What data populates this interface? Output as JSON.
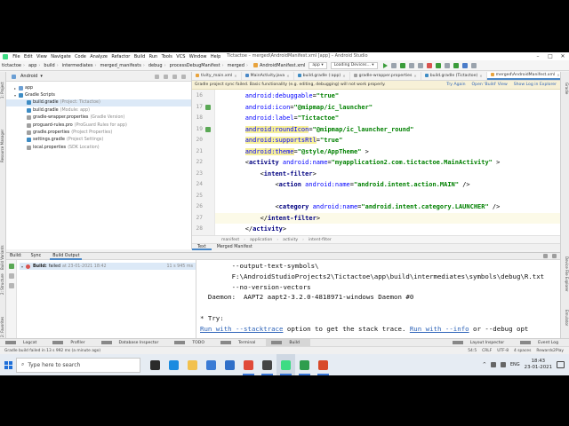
{
  "window": {
    "title": "Tictactoe – merged\\AndroidManifest.xml [app] – Android Studio",
    "menu": [
      "File",
      "Edit",
      "View",
      "Navigate",
      "Code",
      "Analyze",
      "Refactor",
      "Build",
      "Run",
      "Tools",
      "VCS",
      "Window",
      "Help"
    ],
    "controls": [
      "–",
      "□",
      "✕"
    ]
  },
  "navbar": {
    "breadcrumbs": [
      "tictactoe",
      "app",
      "build",
      "intermediates",
      "merged_manifests",
      "debug",
      "processDebugManifest",
      "merged"
    ],
    "file": "AndroidManifest.xml",
    "config_combo": "app",
    "device_combo": "Loading Devices..."
  },
  "project_panel": {
    "view_combo": "Android",
    "tree": [
      {
        "label": "app",
        "hint": "",
        "icon": "folder",
        "indent": 1,
        "caret": "▸",
        "selected": false
      },
      {
        "label": "Gradle Scripts",
        "hint": "",
        "icon": "gradle",
        "indent": 1,
        "caret": "▾",
        "selected": false
      },
      {
        "label": "build.gradle",
        "hint": "(Project: Tictactoe)",
        "icon": "gradle",
        "indent": 2,
        "caret": "",
        "selected": true
      },
      {
        "label": "build.gradle",
        "hint": "(Module: app)",
        "icon": "gradle",
        "indent": 2,
        "caret": "",
        "selected": false
      },
      {
        "label": "gradle-wrapper.properties",
        "hint": "(Gradle Version)",
        "icon": "props",
        "indent": 2,
        "caret": "",
        "selected": false
      },
      {
        "label": "proguard-rules.pro",
        "hint": "(ProGuard Rules for app)",
        "icon": "props",
        "indent": 2,
        "caret": "",
        "selected": false
      },
      {
        "label": "gradle.properties",
        "hint": "(Project Properties)",
        "icon": "props",
        "indent": 2,
        "caret": "",
        "selected": false
      },
      {
        "label": "settings.gradle",
        "hint": "(Project Settings)",
        "icon": "gradle",
        "indent": 2,
        "caret": "",
        "selected": false
      },
      {
        "label": "local.properties",
        "hint": "(SDK Location)",
        "icon": "props",
        "indent": 2,
        "caret": "",
        "selected": false
      }
    ]
  },
  "editor_tabs": [
    {
      "label": "tivity_main.xml",
      "active": false,
      "color": "#e8a33d"
    },
    {
      "label": "MainActivity.java",
      "active": false,
      "color": "#4a88c7"
    },
    {
      "label": "build.gradle (:app)",
      "active": false,
      "color": "#3e8cc4"
    },
    {
      "label": "gradle-wrapper.properties",
      "active": false,
      "color": "#a0a0a0"
    },
    {
      "label": "build.gradle (Tictactoe)",
      "active": false,
      "color": "#3e8cc4"
    },
    {
      "label": "merged\\AndroidManifest.xml",
      "active": true,
      "color": "#e8a33d"
    }
  ],
  "banner": {
    "message": "Gradle project sync failed. Basic functionality (e.g. editing, debugging) will not work properly.",
    "actions": [
      "Try Again",
      "Open 'Build' View",
      "Show Log in Explorer"
    ]
  },
  "editor": {
    "lines": [
      {
        "n": "16",
        "marker": false,
        "hl": false,
        "tokens": [
          [
            "",
            "        "
          ],
          [
            "attr",
            "android:debuggable"
          ],
          [
            "brk",
            "="
          ],
          [
            "val",
            "\"true\""
          ]
        ]
      },
      {
        "n": "17",
        "marker": true,
        "hl": false,
        "tokens": [
          [
            "",
            "        "
          ],
          [
            "attr",
            "android:icon"
          ],
          [
            "brk",
            "="
          ],
          [
            "val",
            "\"@mipmap/ic_launcher\""
          ]
        ]
      },
      {
        "n": "18",
        "marker": false,
        "hl": false,
        "tokens": [
          [
            "",
            "        "
          ],
          [
            "attr",
            "android:label"
          ],
          [
            "brk",
            "="
          ],
          [
            "val",
            "\"Tictactoe\""
          ]
        ]
      },
      {
        "n": "19",
        "marker": true,
        "hl": false,
        "tokens": [
          [
            "",
            "        "
          ],
          [
            "attr hlbg",
            "android:roundIcon"
          ],
          [
            "brk",
            "="
          ],
          [
            "val",
            "\"@mipmap/ic_launcher_round\""
          ]
        ]
      },
      {
        "n": "20",
        "marker": false,
        "hl": false,
        "tokens": [
          [
            "",
            "        "
          ],
          [
            "attr hlbg",
            "android:supportsRtl"
          ],
          [
            "brk",
            "="
          ],
          [
            "val",
            "\"true\""
          ]
        ]
      },
      {
        "n": "21",
        "marker": false,
        "hl": false,
        "tokens": [
          [
            "",
            "        "
          ],
          [
            "attr hlbg",
            "android:theme"
          ],
          [
            "brk",
            "="
          ],
          [
            "val",
            "\"@style/AppTheme\""
          ],
          [
            "brk",
            " >"
          ]
        ]
      },
      {
        "n": "22",
        "marker": false,
        "hl": false,
        "tokens": [
          [
            "",
            "        "
          ],
          [
            "brk",
            "<"
          ],
          [
            "tag",
            "activity"
          ],
          [
            "",
            " "
          ],
          [
            "attr",
            "android:name"
          ],
          [
            "brk",
            "="
          ],
          [
            "val",
            "\"myapplication2.com.tictactoe.MainActivity\""
          ],
          [
            "brk",
            " >"
          ]
        ]
      },
      {
        "n": "23",
        "marker": false,
        "hl": false,
        "tokens": [
          [
            "",
            "            "
          ],
          [
            "brk",
            "<"
          ],
          [
            "tag",
            "intent-filter"
          ],
          [
            "brk",
            ">"
          ]
        ]
      },
      {
        "n": "24",
        "marker": false,
        "hl": false,
        "tokens": [
          [
            "",
            "                "
          ],
          [
            "brk",
            "<"
          ],
          [
            "tag",
            "action"
          ],
          [
            "",
            " "
          ],
          [
            "attr",
            "android:name"
          ],
          [
            "brk",
            "="
          ],
          [
            "val",
            "\"android.intent.action.MAIN\""
          ],
          [
            "brk",
            " />"
          ]
        ]
      },
      {
        "n": "25",
        "marker": false,
        "hl": false,
        "tokens": [
          [
            "",
            ""
          ]
        ]
      },
      {
        "n": "26",
        "marker": false,
        "hl": false,
        "tokens": [
          [
            "",
            "                "
          ],
          [
            "brk",
            "<"
          ],
          [
            "tag",
            "category"
          ],
          [
            "",
            " "
          ],
          [
            "attr",
            "android:name"
          ],
          [
            "brk",
            "="
          ],
          [
            "val",
            "\"android.intent.category.LAUNCHER\""
          ],
          [
            "brk",
            " />"
          ]
        ]
      },
      {
        "n": "27",
        "marker": false,
        "hl": true,
        "tokens": [
          [
            "",
            "            "
          ],
          [
            "brk",
            "</"
          ],
          [
            "tag",
            "intent-filter"
          ],
          [
            "brk",
            ">"
          ]
        ]
      },
      {
        "n": "28",
        "marker": false,
        "hl": false,
        "tokens": [
          [
            "",
            "        "
          ],
          [
            "brk",
            "</"
          ],
          [
            "tag",
            "activity"
          ],
          [
            "brk",
            ">"
          ]
        ]
      }
    ]
  },
  "editor_breadcrumb": [
    "manifest",
    "application",
    "activity",
    "intent-filter"
  ],
  "editor_view_tabs": [
    {
      "label": "Text",
      "active": true
    },
    {
      "label": "Merged Manifest",
      "active": false
    }
  ],
  "build_panel": {
    "label": "Build:",
    "tabs": [
      {
        "label": "Sync",
        "active": false
      },
      {
        "label": "Build Output",
        "active": true
      }
    ],
    "row": {
      "status": "Build:",
      "result": "failed",
      "time": "at 23-01-2021 18:42",
      "duration": "11 s 945 ms"
    },
    "console": [
      {
        "text": "        --output-text-symbols\\",
        "link": ""
      },
      {
        "text": "        F:\\AndroidStudioProjects2\\Tictactoe\\app\\build\\intermediates\\symbols\\debug\\R.txt",
        "link": ""
      },
      {
        "text": "        --no-version-vectors",
        "link": ""
      },
      {
        "text": "  Daemon:  AAPT2 aapt2-3.2.0-4818971-windows Daemon #0",
        "link": ""
      },
      {
        "text": "",
        "link": ""
      },
      {
        "text": "* Try:",
        "link": ""
      }
    ],
    "try_line": {
      "link1": "Run with --stacktrace",
      "mid": " option to get the stack trace. ",
      "link2": "Run with --info",
      "tail": " or --debug opt"
    }
  },
  "left_tool_tabs": [
    "1: Project",
    "Resource Manager",
    "Build Variants",
    "2: Structure",
    "2: Favorites"
  ],
  "right_tool_tabs": [
    "Gradle",
    "Device File Explorer",
    "Emulator"
  ],
  "bottom_tabs": [
    {
      "label": "Logcat",
      "active": false
    },
    {
      "label": "Profiler",
      "active": false
    },
    {
      "label": "Database Inspector",
      "active": false
    },
    {
      "label": "TODO",
      "active": false
    },
    {
      "label": "Terminal",
      "active": false
    },
    {
      "label": "Build",
      "active": true
    }
  ],
  "bottom_right_tabs": [
    "Layout Inspector",
    "Event Log"
  ],
  "statusbar": {
    "message": "Gradle build failed in 13 s 992 ms (a minute ago)",
    "right": [
      "54:5",
      "CRLF",
      "UTF-8",
      "4 spaces",
      "Rewards2Play"
    ]
  },
  "taskbar": {
    "search_placeholder": "Type here to search",
    "apps": [
      {
        "name": "task-view",
        "color": "#2b2b2b",
        "running": false
      },
      {
        "name": "edge",
        "color": "#1b8be0",
        "running": false
      },
      {
        "name": "file-explorer",
        "color": "#f2c14e",
        "running": false
      },
      {
        "name": "store",
        "color": "#3a7bd5",
        "running": false
      },
      {
        "name": "mail",
        "color": "#2f6fc9",
        "running": false
      },
      {
        "name": "chrome",
        "color": "#e04a3a",
        "running": true
      },
      {
        "name": "recorder",
        "color": "#444444",
        "running": true
      },
      {
        "name": "android-studio",
        "color": "#3ddc84",
        "running": true
      },
      {
        "name": "camtasia",
        "color": "#2e9d4e",
        "running": true
      },
      {
        "name": "media-app",
        "color": "#d84a2a",
        "running": true
      }
    ],
    "lang": "ENG",
    "time": "18:43",
    "date": "23-01-2021"
  }
}
